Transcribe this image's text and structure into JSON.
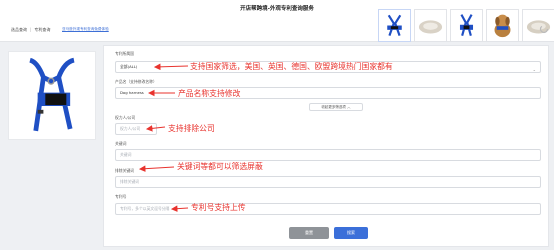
{
  "header": {
    "title": "开店帮跨境-外观专利查询服务",
    "breadcrumb": [
      "选品查询",
      "专利查询"
    ],
    "note_link": "亚马逊外观专利查询免费体验"
  },
  "thumbnails": [
    {
      "icon": "blue-harness-icon",
      "selected": true
    },
    {
      "icon": "pet-bed-icon",
      "selected": false
    },
    {
      "icon": "blue-harness-icon",
      "selected": false
    },
    {
      "icon": "dog-icon",
      "selected": false
    },
    {
      "icon": "pet-bed-icon",
      "selected": false
    }
  ],
  "product_image": {
    "icon": "blue-harness-icon"
  },
  "form": {
    "country": {
      "label": "专利所属国",
      "value": "全部(ALL)"
    },
    "product_name": {
      "label": "产品名（支持修改名称）",
      "value": "Dog harness"
    },
    "expand_label": "收起更多筛选项 ︿",
    "assignee": {
      "label": "权力人/公司",
      "placeholder": "权力人/公司"
    },
    "keywords": {
      "label": "关键词",
      "placeholder": "关键词"
    },
    "exclude_keywords": {
      "label": "排除关键词",
      "placeholder": "排除关键词"
    },
    "patent_number": {
      "label": "专利号",
      "placeholder": "专利号，多个以英文逗号分隔"
    },
    "reset_label": "重置",
    "search_label": "搜索"
  },
  "annotations": {
    "country": "支持国家筛选，美国、英国、德国、欧盟跨境热门国家都有",
    "product_name": "产品名称支持修改",
    "assignee": "支持排除公司",
    "keywords": "关键词等都可以筛选屏蔽",
    "patent_number": "专利号支持上传",
    "color": "#e8332e"
  },
  "colors": {
    "accent": "#3b6fd9",
    "harness": "#1f4fc4",
    "reset": "#8f9398"
  }
}
